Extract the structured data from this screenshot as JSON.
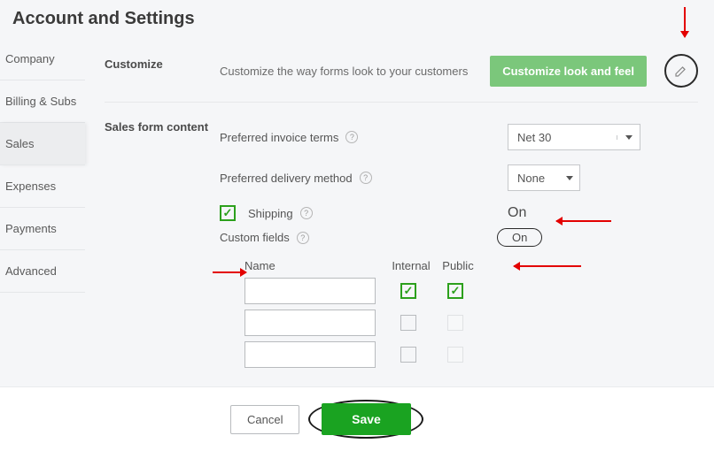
{
  "page_title": "Account and Settings",
  "sidebar": {
    "items": [
      {
        "label": "Company"
      },
      {
        "label": "Billing & Subs"
      },
      {
        "label": "Sales"
      },
      {
        "label": "Expenses"
      },
      {
        "label": "Payments"
      },
      {
        "label": "Advanced"
      }
    ]
  },
  "sections": {
    "customize": {
      "label": "Customize",
      "desc": "Customize the way forms look to your customers",
      "button": "Customize look and feel"
    },
    "sales_form": {
      "label": "Sales form content",
      "invoice_terms_label": "Preferred invoice terms",
      "invoice_terms_value": "Net 30",
      "delivery_label": "Preferred delivery method",
      "delivery_value": "None",
      "shipping_label": "Shipping",
      "shipping_status": "On",
      "custom_fields_label": "Custom fields",
      "custom_fields_status": "On",
      "cf_headers": {
        "name": "Name",
        "internal": "Internal",
        "public": "Public"
      }
    }
  },
  "footer": {
    "cancel": "Cancel",
    "save": "Save"
  },
  "help_char": "?"
}
